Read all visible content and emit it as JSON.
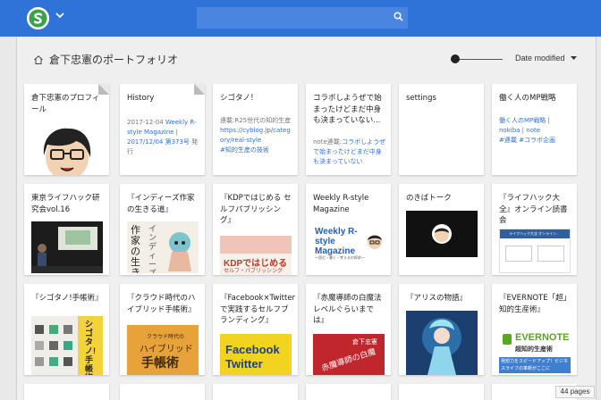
{
  "search": {
    "placeholder": ""
  },
  "breadcrumb": {
    "title": "倉下忠憲のポートフォリオ"
  },
  "sort": {
    "label": "Date modified"
  },
  "zoom": {
    "level": 0.0
  },
  "pages_count": "44 pages",
  "colors": {
    "topbar": "#2f72d8",
    "link": "#2f72d8",
    "accent_green": "#3aa24a"
  },
  "cards": [
    {
      "title": "倉下忠憲のプロフィール",
      "meta": []
    },
    {
      "title": "History",
      "meta": [
        "2017-12-04 ",
        "Weekly R-style Magazine",
        " | ",
        "2017/12/04 第373号",
        " 発行"
      ]
    },
    {
      "title": "シゴタノ！",
      "meta": [
        "連載:R25世代の知的生産",
        "https://cyblog.jp/category/real-style",
        "#知的生産の技術"
      ]
    },
    {
      "title": "コラボしようぜで始まったけどまだ中身も決まっていない...",
      "meta": [
        "note連載:",
        "コラボしようぜで始まったけどまだ中身も決まっていない"
      ]
    },
    {
      "title": "settings",
      "meta": []
    },
    {
      "title": "働く人のMP戦略",
      "meta": [
        "働く人のMP戦略",
        " | ",
        "nokiba",
        " | ",
        "note",
        "#連載 #コラボ企画"
      ]
    },
    {
      "title": "東京ライフハック研究会vol.16",
      "meta": []
    },
    {
      "title": "『インディーズ作家の生きる道』",
      "meta": []
    },
    {
      "title": "『KDPではじめる セルフパブリッシング』",
      "meta": []
    },
    {
      "title": "Weekly R-style Magazine",
      "meta": []
    },
    {
      "title": "のきばトーク",
      "meta": []
    },
    {
      "title": "『ライフハック大全』オンライン読書会",
      "meta": []
    },
    {
      "title": "『シゴタノ!手帳術』",
      "meta": []
    },
    {
      "title": "『クラウド時代のハイブリッド手帳術』",
      "meta": []
    },
    {
      "title": "『Facebook×Twitterで実践するセルフブランディング』",
      "meta": []
    },
    {
      "title": "『赤魔導師の白魔法レベルぐらいまでは』",
      "meta": []
    },
    {
      "title": "『アリスの物語』",
      "meta": []
    },
    {
      "title": "『EVERNOTE「超」知的生産術』",
      "meta": []
    }
  ],
  "thumbs": {
    "magazine_title": "Weekly R-style Magazine",
    "magazine_sub": "〜読む・書く・考えるの探求〜",
    "book_indies": "作家の生きる道",
    "book_indies_side": "インディーズ",
    "book_kdp": "KDPではじめる",
    "book_kdp_sub": "セルフ・パブリッシング",
    "book_hybrid_top": "クラウド時代の",
    "book_hybrid_mid": "ハイブリッド",
    "book_hybrid_bot": "手帳術",
    "book_fb_line1": "Facebook",
    "book_fb_line2": "Twitter",
    "book_akama_top": "倉下忠憲",
    "book_akama": "赤魔導師の白魔",
    "book_evernote": "EVERNOTE",
    "book_evernote_sub": "超知的生産術",
    "book_evernote_foot": "発想力をスピードアップ！ビジネスライフの革新がここに",
    "lifehack_header": "ライフハック大全 オンライン...",
    "shigotano_side": "シゴタノ!手帳術"
  }
}
